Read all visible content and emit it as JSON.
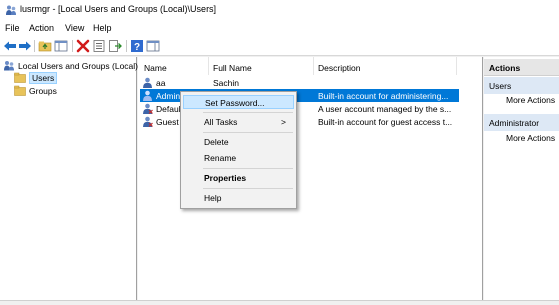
{
  "window": {
    "title": "lusrmgr - [Local Users and Groups (Local)\\Users]"
  },
  "menu": [
    "File",
    "Action",
    "View",
    "Help"
  ],
  "toolbar": {
    "buttons": [
      "back-icon",
      "forward-icon",
      "up-folder-icon",
      "show-hide-tree-icon",
      "delete-icon",
      "properties-icon",
      "export-list-icon",
      "help-icon",
      "show-hide-action-pane-icon"
    ]
  },
  "tree": {
    "root": "Local Users and Groups (Local)",
    "children": [
      "Users",
      "Groups"
    ],
    "selected": "Users"
  },
  "list": {
    "columns": [
      "Name",
      "Full Name",
      "Description"
    ],
    "rows": [
      {
        "name": "aa",
        "full_name": "Sachin",
        "description": ""
      },
      {
        "name": "Admin",
        "full_name": "",
        "description": "Built-in account for administering..."
      },
      {
        "name": "Defaul",
        "full_name": "",
        "description": "A user account managed by the s..."
      },
      {
        "name": "Guest",
        "full_name": "",
        "description": "Built-in account for guest access t..."
      }
    ],
    "selected_row": 1
  },
  "actions": {
    "title": "Actions",
    "sections": [
      {
        "header": "Users",
        "items": [
          "More Actions"
        ]
      },
      {
        "header": "Administrator",
        "items": [
          "More Actions"
        ]
      }
    ]
  },
  "context_menu": {
    "items": [
      {
        "label": "Set Password...",
        "highlighted": true
      },
      {
        "label": "All Tasks",
        "submenu": true,
        "arrow": ">"
      },
      {
        "label": "Delete"
      },
      {
        "label": "Rename"
      },
      {
        "label": "Properties",
        "bold": true
      },
      {
        "label": "Help"
      }
    ]
  },
  "colors": {
    "selection": "#0078d7",
    "hover": "#cce8ff",
    "folder": "#e8c35a"
  }
}
